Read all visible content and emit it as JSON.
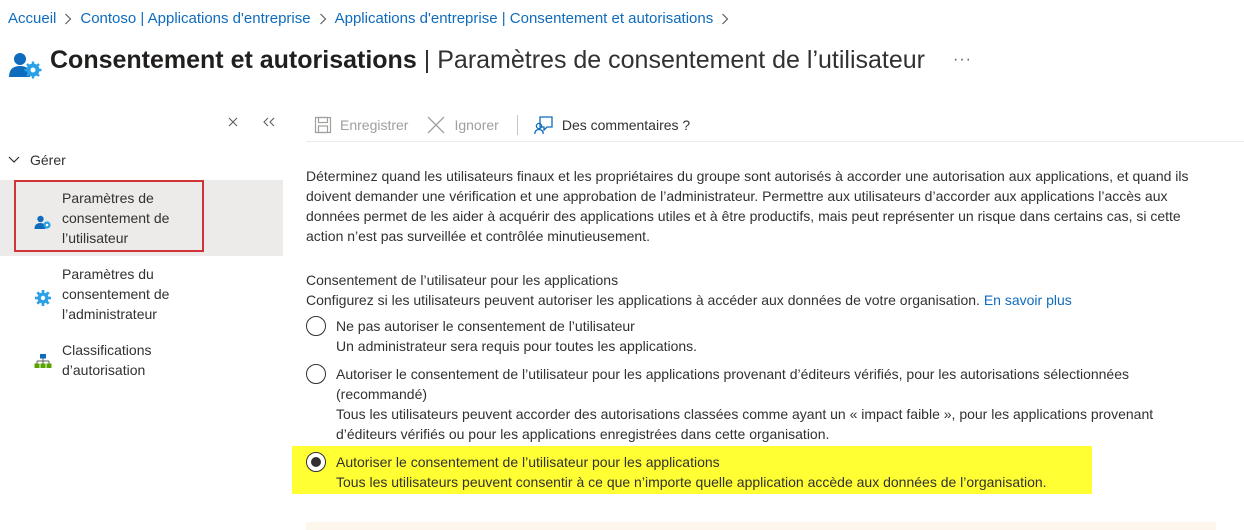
{
  "breadcrumb": [
    {
      "label": "Accueil"
    },
    {
      "label": "Contoso | Applications d'entreprise"
    },
    {
      "label": "Applications d'entreprise | Consentement et autorisations"
    }
  ],
  "header": {
    "title_main": "Consentement et autorisations",
    "title_sub": "Paramètres de consentement de l’utilisateur",
    "more": "···"
  },
  "sidebar": {
    "section": "Gérer",
    "items": [
      {
        "label": "Paramètres de consentement de l’utilisateur",
        "icon": "user-gear-icon",
        "active": true
      },
      {
        "label": "Paramètres du consentement de l’administrateur",
        "icon": "gear-icon",
        "active": false
      },
      {
        "label": "Classifications d’autorisation",
        "icon": "hierarchy-icon",
        "active": false
      }
    ]
  },
  "toolbar": {
    "save_label": "Enregistrer",
    "discard_label": "Ignorer",
    "feedback_label": "Des commentaires ?"
  },
  "main": {
    "description": "Déterminez quand les utilisateurs finaux et les propriétaires du groupe sont autorisés à accorder une autorisation aux applications, et quand ils doivent demander une vérification et une approbation de l’administrateur. Permettre aux utilisateurs d’accorder aux applications l’accès aux données permet de les aider à acquérir des applications utiles et à être productifs, mais peut représenter un risque dans certains cas, si cette action n’est pas surveillée et contrôlée minutieusement.",
    "group_title": "Consentement de l’utilisateur pour les applications",
    "group_desc": "Configurez si les utilisateurs peuvent autoriser les applications à accéder aux données de votre organisation.",
    "learn_more": "En savoir plus",
    "options": [
      {
        "title": "Ne pas autoriser le consentement de l’utilisateur",
        "desc": "Un administrateur sera requis pour toutes les applications.",
        "checked": false
      },
      {
        "title": "Autoriser le consentement de l’utilisateur pour les applications provenant d’éditeurs vérifiés, pour les autorisations sélectionnées (recommandé)",
        "desc": "Tous les utilisateurs peuvent accorder des autorisations classées comme ayant un « impact faible », pour les applications provenant d’éditeurs vérifiés ou pour les applications enregistrées dans cette organisation.",
        "checked": false
      },
      {
        "title": "Autoriser le consentement de l’utilisateur pour les applications",
        "desc": "Tous les utilisateurs peuvent consentir à ce que n’importe quelle application accède aux données de l’organisation.",
        "checked": true
      }
    ]
  },
  "colors": {
    "link": "#0f6cbd",
    "highlight": "#ffff33",
    "callout_border": "#d13438",
    "active_nav": "#edebe9"
  }
}
